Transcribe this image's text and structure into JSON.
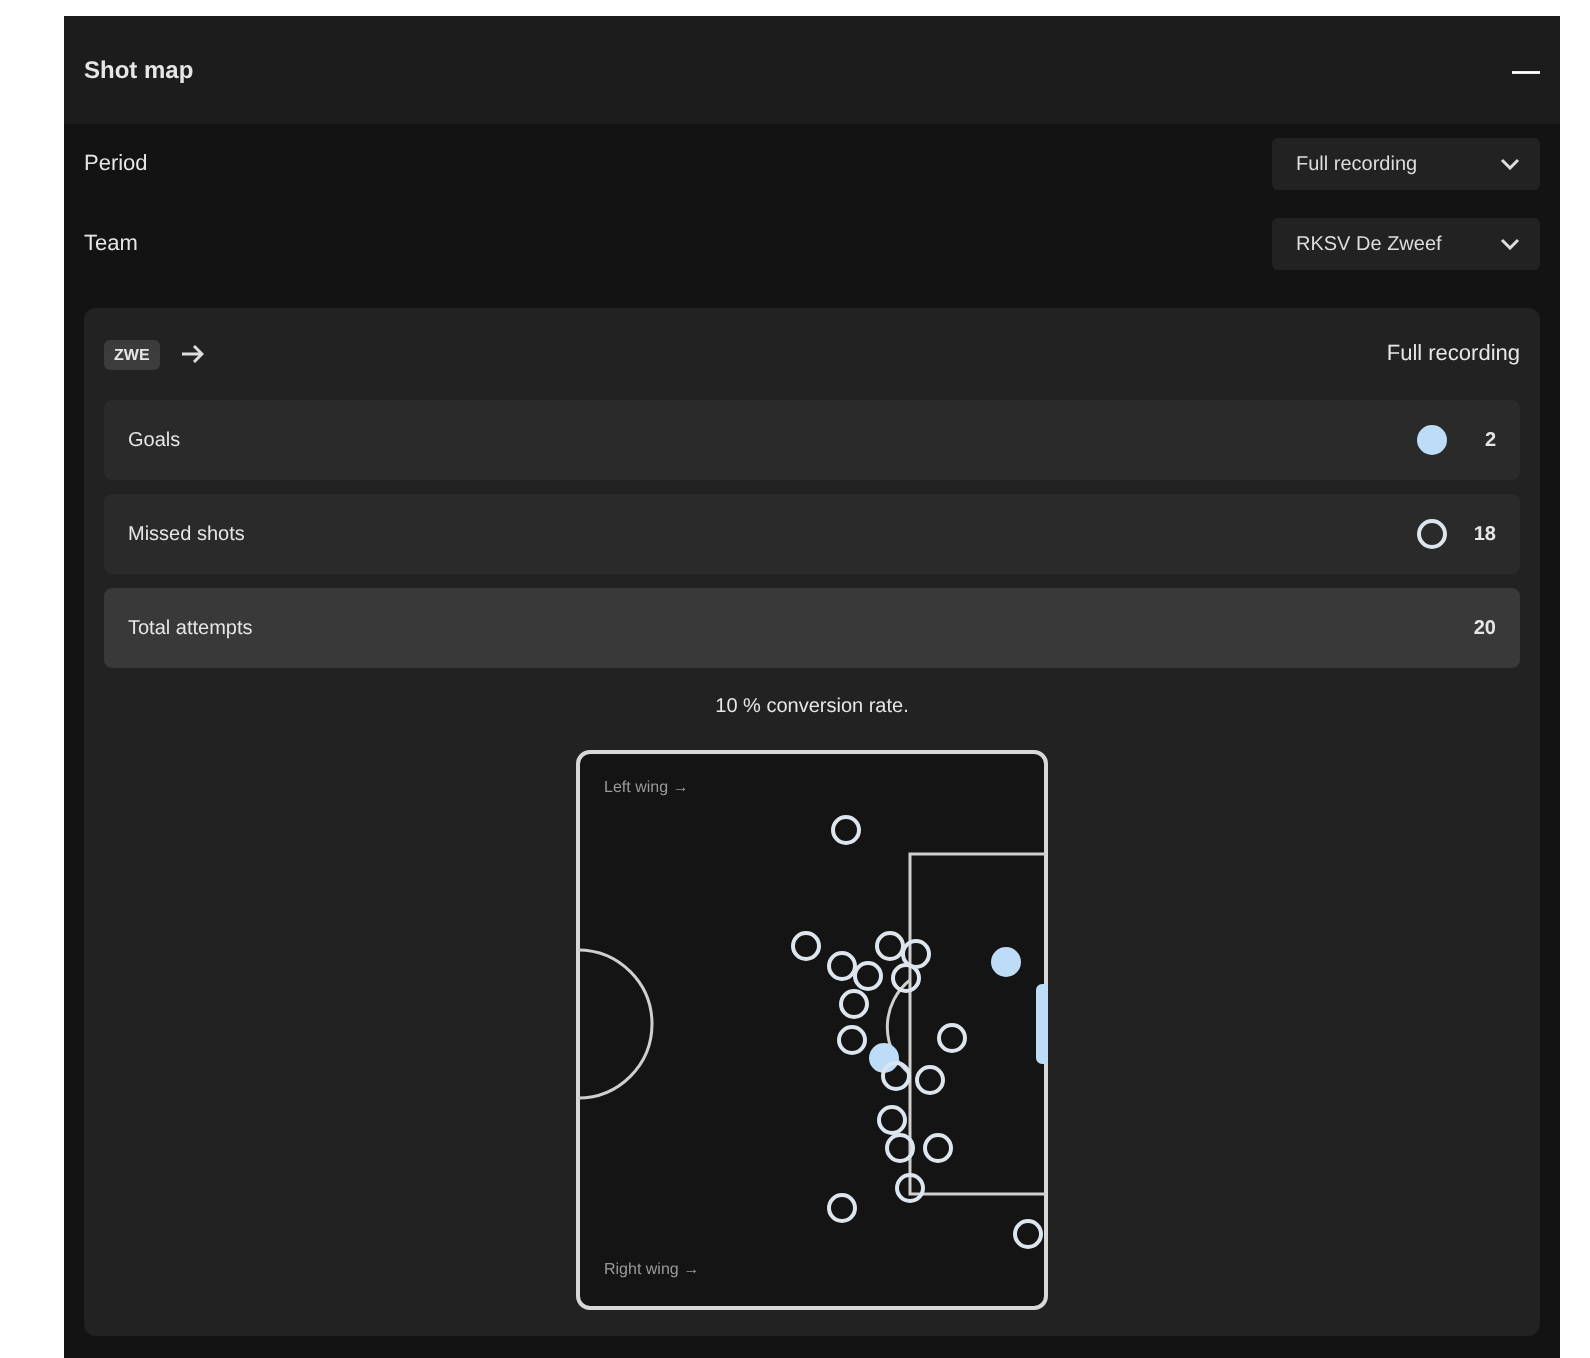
{
  "panel": {
    "title": "Shot map",
    "collapse_symbol": "—"
  },
  "filters": [
    {
      "label": "Period",
      "value": "Full recording"
    },
    {
      "label": "Team",
      "value": "RKSV De Zweef"
    }
  ],
  "card": {
    "team_badge": "ZWE",
    "period": "Full recording",
    "stats": [
      {
        "kind": "goal",
        "label": "Goals",
        "count": "2"
      },
      {
        "kind": "miss",
        "label": "Missed shots",
        "count": "18"
      },
      {
        "kind": "total",
        "label": "Total attempts",
        "count": "20"
      }
    ],
    "conversion": "10 % conversion rate.",
    "pitch": {
      "top_label": "Left wing →",
      "bottom_label": "Right wing →"
    }
  }
}
